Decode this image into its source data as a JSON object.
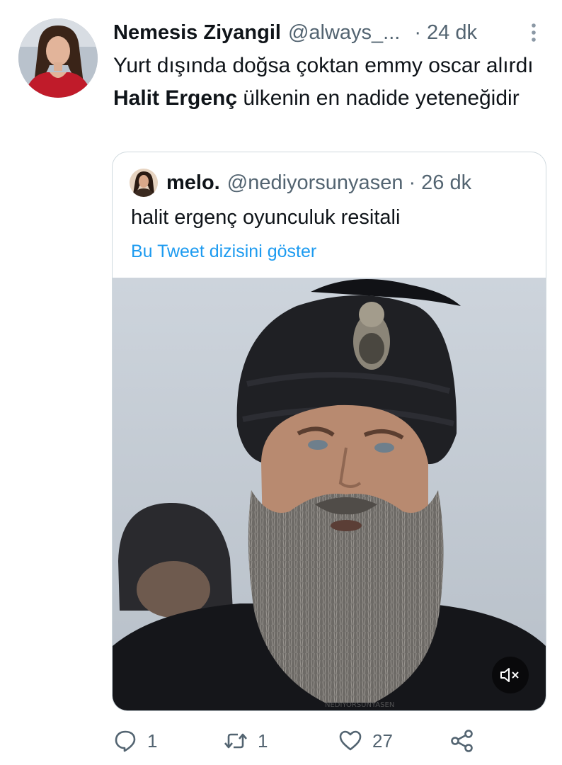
{
  "tweet": {
    "display_name": "Nemesis Ziyangil",
    "handle": "@always_...",
    "separator": "·",
    "time": "24 dk",
    "text_part1": "Yurt dışında doğsa çoktan emmy oscar alırdı ",
    "text_bold": "Halit Ergenç",
    "text_part2": " ülkenin en nadide yeteneğidir"
  },
  "quoted": {
    "display_name": "melo.",
    "handle": "@nediyorsunyasen",
    "separator": "·",
    "time": "26 dk",
    "text": "halit ergenç oyunculuk resitali",
    "thread_link": "Bu Tweet dizisini göster",
    "media_watermark": "NEDIYORSUNYASEN"
  },
  "actions": {
    "reply_count": "1",
    "retweet_count": "1",
    "like_count": "27"
  },
  "colors": {
    "text": "#0f1419",
    "secondary": "#536471",
    "link": "#1d9bf0",
    "border": "#cfd9de"
  },
  "icons": {
    "reply": "reply-icon",
    "retweet": "retweet-icon",
    "like": "heart-icon",
    "share": "share-icon",
    "more": "more-icon",
    "mute": "volume-muted-icon"
  }
}
